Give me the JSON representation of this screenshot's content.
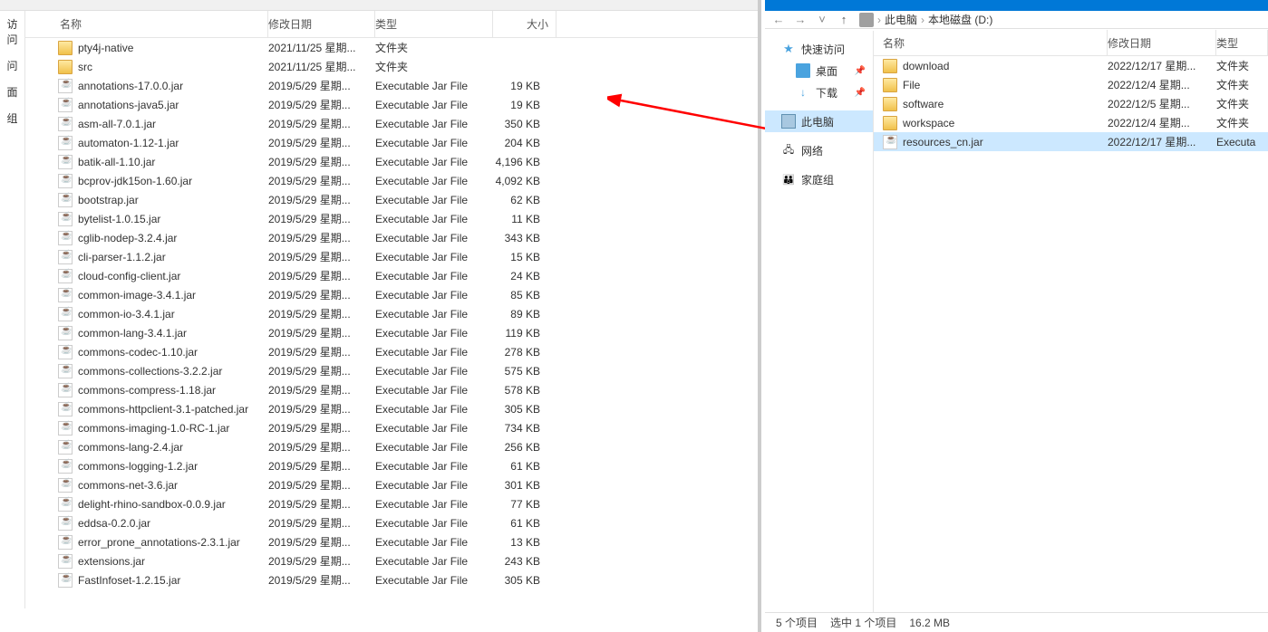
{
  "left": {
    "sidebar_fragments": [
      "访问",
      "问",
      "面",
      "组"
    ],
    "columns": {
      "name": "名称",
      "date": "修改日期",
      "type": "类型",
      "size": "大小"
    },
    "type_folder": "文件夹",
    "type_jar": "Executable Jar File",
    "rows": [
      {
        "icon": "folder",
        "name": "pty4j-native",
        "date": "2021/11/25 星期...",
        "type": "文件夹",
        "size": ""
      },
      {
        "icon": "folder",
        "name": "src",
        "date": "2021/11/25 星期...",
        "type": "文件夹",
        "size": ""
      },
      {
        "icon": "jar",
        "name": "annotations-17.0.0.jar",
        "date": "2019/5/29 星期...",
        "type": "Executable Jar File",
        "size": "19 KB"
      },
      {
        "icon": "jar",
        "name": "annotations-java5.jar",
        "date": "2019/5/29 星期...",
        "type": "Executable Jar File",
        "size": "19 KB"
      },
      {
        "icon": "jar",
        "name": "asm-all-7.0.1.jar",
        "date": "2019/5/29 星期...",
        "type": "Executable Jar File",
        "size": "350 KB"
      },
      {
        "icon": "jar",
        "name": "automaton-1.12-1.jar",
        "date": "2019/5/29 星期...",
        "type": "Executable Jar File",
        "size": "204 KB"
      },
      {
        "icon": "jar",
        "name": "batik-all-1.10.jar",
        "date": "2019/5/29 星期...",
        "type": "Executable Jar File",
        "size": "4,196 KB"
      },
      {
        "icon": "jar",
        "name": "bcprov-jdk15on-1.60.jar",
        "date": "2019/5/29 星期...",
        "type": "Executable Jar File",
        "size": "4,092 KB"
      },
      {
        "icon": "jar",
        "name": "bootstrap.jar",
        "date": "2019/5/29 星期...",
        "type": "Executable Jar File",
        "size": "62 KB"
      },
      {
        "icon": "jar",
        "name": "bytelist-1.0.15.jar",
        "date": "2019/5/29 星期...",
        "type": "Executable Jar File",
        "size": "11 KB"
      },
      {
        "icon": "jar",
        "name": "cglib-nodep-3.2.4.jar",
        "date": "2019/5/29 星期...",
        "type": "Executable Jar File",
        "size": "343 KB"
      },
      {
        "icon": "jar",
        "name": "cli-parser-1.1.2.jar",
        "date": "2019/5/29 星期...",
        "type": "Executable Jar File",
        "size": "15 KB"
      },
      {
        "icon": "jar",
        "name": "cloud-config-client.jar",
        "date": "2019/5/29 星期...",
        "type": "Executable Jar File",
        "size": "24 KB"
      },
      {
        "icon": "jar",
        "name": "common-image-3.4.1.jar",
        "date": "2019/5/29 星期...",
        "type": "Executable Jar File",
        "size": "85 KB"
      },
      {
        "icon": "jar",
        "name": "common-io-3.4.1.jar",
        "date": "2019/5/29 星期...",
        "type": "Executable Jar File",
        "size": "89 KB"
      },
      {
        "icon": "jar",
        "name": "common-lang-3.4.1.jar",
        "date": "2019/5/29 星期...",
        "type": "Executable Jar File",
        "size": "119 KB"
      },
      {
        "icon": "jar",
        "name": "commons-codec-1.10.jar",
        "date": "2019/5/29 星期...",
        "type": "Executable Jar File",
        "size": "278 KB"
      },
      {
        "icon": "jar",
        "name": "commons-collections-3.2.2.jar",
        "date": "2019/5/29 星期...",
        "type": "Executable Jar File",
        "size": "575 KB"
      },
      {
        "icon": "jar",
        "name": "commons-compress-1.18.jar",
        "date": "2019/5/29 星期...",
        "type": "Executable Jar File",
        "size": "578 KB"
      },
      {
        "icon": "jar",
        "name": "commons-httpclient-3.1-patched.jar",
        "date": "2019/5/29 星期...",
        "type": "Executable Jar File",
        "size": "305 KB"
      },
      {
        "icon": "jar",
        "name": "commons-imaging-1.0-RC-1.jar",
        "date": "2019/5/29 星期...",
        "type": "Executable Jar File",
        "size": "734 KB"
      },
      {
        "icon": "jar",
        "name": "commons-lang-2.4.jar",
        "date": "2019/5/29 星期...",
        "type": "Executable Jar File",
        "size": "256 KB"
      },
      {
        "icon": "jar",
        "name": "commons-logging-1.2.jar",
        "date": "2019/5/29 星期...",
        "type": "Executable Jar File",
        "size": "61 KB"
      },
      {
        "icon": "jar",
        "name": "commons-net-3.6.jar",
        "date": "2019/5/29 星期...",
        "type": "Executable Jar File",
        "size": "301 KB"
      },
      {
        "icon": "jar",
        "name": "delight-rhino-sandbox-0.0.9.jar",
        "date": "2019/5/29 星期...",
        "type": "Executable Jar File",
        "size": "77 KB"
      },
      {
        "icon": "jar",
        "name": "eddsa-0.2.0.jar",
        "date": "2019/5/29 星期...",
        "type": "Executable Jar File",
        "size": "61 KB"
      },
      {
        "icon": "jar",
        "name": "error_prone_annotations-2.3.1.jar",
        "date": "2019/5/29 星期...",
        "type": "Executable Jar File",
        "size": "13 KB"
      },
      {
        "icon": "jar",
        "name": "extensions.jar",
        "date": "2019/5/29 星期...",
        "type": "Executable Jar File",
        "size": "243 KB"
      },
      {
        "icon": "jar",
        "name": "FastInfoset-1.2.15.jar",
        "date": "2019/5/29 星期...",
        "type": "Executable Jar File",
        "size": "305 KB"
      }
    ]
  },
  "right": {
    "breadcrumb": {
      "this_pc": "此电脑",
      "drive": "本地磁盘 (D:)"
    },
    "sidebar": {
      "quick": "快速访问",
      "desktop": "桌面",
      "downloads": "下载",
      "this_pc": "此电脑",
      "network": "网络",
      "homegroup": "家庭组"
    },
    "columns": {
      "name": "名称",
      "date": "修改日期",
      "type": "类型"
    },
    "rows": [
      {
        "icon": "folder",
        "name": "download",
        "date": "2022/12/17 星期...",
        "type": "文件夹",
        "sel": false
      },
      {
        "icon": "folder",
        "name": "File",
        "date": "2022/12/4 星期...",
        "type": "文件夹",
        "sel": false
      },
      {
        "icon": "folder",
        "name": "software",
        "date": "2022/12/5 星期...",
        "type": "文件夹",
        "sel": false
      },
      {
        "icon": "folder",
        "name": "workspace",
        "date": "2022/12/4 星期...",
        "type": "文件夹",
        "sel": false
      },
      {
        "icon": "jar",
        "name": "resources_cn.jar",
        "date": "2022/12/17 星期...",
        "type": "Executa",
        "sel": true
      }
    ],
    "status": {
      "count": "5 个项目",
      "selected": "选中 1 个项目",
      "size": "16.2 MB"
    }
  }
}
